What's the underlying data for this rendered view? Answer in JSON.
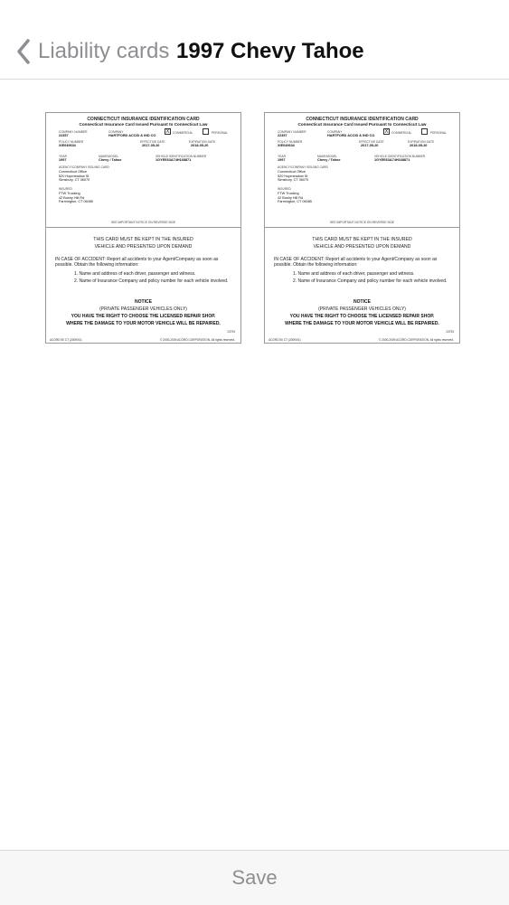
{
  "nav": {
    "back_label": "Liability cards",
    "title": "1997 Chevy Tahoe"
  },
  "cards": [
    {
      "title": "CONNECTICUT INSURANCE IDENTIFICATION CARD",
      "subtitle": "Connecticut Insurance Card Issued Pursuant to Connecticut Law",
      "company_number_label": "COMPANY NUMBER",
      "company_number": "22357",
      "company_label": "COMPANY",
      "company": "HARTFORD ACCID & IND CO",
      "commercial_label": "COMMERCIAL",
      "personal_label": "PERSONAL",
      "commercial_mark": "X",
      "policy_number_label": "POLICY NUMBER",
      "policy_number": "XIE049634",
      "effective_label": "EFFECTIVE DATE",
      "effective_date": "2017-05-20",
      "expiration_label": "EXPIRATION DATE",
      "expiration_date": "2018-05-20",
      "year_label": "YEAR",
      "year": "1997",
      "make_label": "MAKE/MODEL",
      "make_model": "Chevy / Tahoe",
      "vin_label": "VEHICLE IDENTIFICATION NUMBER",
      "vin": "1GYEE63A74H168871",
      "agency_label": "AGENCY/COMPANY ISSUING CARD",
      "agency": "Connecticut Office\n520 Hopmeadow St\nSimsbury, CT 06070",
      "insured_label": "INSURED",
      "insured": "FTW Trucking\n42 Bushy Hill Rd\nFarmington, CT 06085",
      "reverse_notice": "SEE IMPORTANT NOTICE ON REVERSE SIDE",
      "keep_line1": "THIS CARD MUST BE KEPT IN THE INSURED",
      "keep_line2": "VEHICLE AND PRESENTED UPON DEMAND",
      "accident_text": "IN CASE OF ACCIDENT:  Report all accidents to your Agent/Company as soon as possible. Obtain the following information:",
      "item1": "1. Name and address of each driver, passenger and witness.",
      "item2": "2. Name of Insurance Company and policy number for each vehicle involved.",
      "notice_title": "NOTICE",
      "notice_sub": "(PRIVATE PASSENGER VEHICLES ONLY)",
      "right_line1": "YOU HAVE THE RIGHT TO CHOOSE THE LICENSED REPAIR SHOP.",
      "right_line2": "WHERE THE DAMAGE TO YOUR MOTOR VEHICLE WILL BE REPAIRED.",
      "form_code": "13793",
      "footer_left": "ACORD 50 CT (2009/01)",
      "footer_right": "© 2000-2009 ACORD CORPORATION. All rights reserved."
    },
    {
      "title": "CONNECTICUT INSURANCE IDENTIFICATION CARD",
      "subtitle": "Connecticut Insurance Card Issued Pursuant to Connecticut Law",
      "company_number_label": "COMPANY NUMBER",
      "company_number": "22357",
      "company_label": "COMPANY",
      "company": "HARTFORD ACCID & IND CO",
      "commercial_label": "COMMERCIAL",
      "personal_label": "PERSONAL",
      "commercial_mark": "X",
      "policy_number_label": "POLICY NUMBER",
      "policy_number": "XIE049634",
      "effective_label": "EFFECTIVE DATE",
      "effective_date": "2017-05-20",
      "expiration_label": "EXPIRATION DATE",
      "expiration_date": "2018-05-20",
      "year_label": "YEAR",
      "year": "1997",
      "make_label": "MAKE/MODEL",
      "make_model": "Chevy / Tahoe",
      "vin_label": "VEHICLE IDENTIFICATION NUMBER",
      "vin": "1GYEE63A74H168871",
      "agency_label": "AGENCY/COMPANY ISSUING CARD",
      "agency": "Connecticut Office\n520 Hopmeadow St\nSimsbury, CT 06070",
      "insured_label": "INSURED",
      "insured": "FTW Trucking\n42 Bushy Hill Rd\nFarmington, CT 06085",
      "reverse_notice": "SEE IMPORTANT NOTICE ON REVERSE SIDE",
      "keep_line1": "THIS CARD MUST BE KEPT IN THE INSURED",
      "keep_line2": "VEHICLE AND PRESENTED UPON DEMAND",
      "accident_text": "IN CASE OF ACCIDENT:  Report all accidents to your Agent/Company as soon as possible. Obtain the following information:",
      "item1": "1. Name and address of each driver, passenger and witness.",
      "item2": "2. Name of Insurance Company and policy number for each vehicle involved.",
      "notice_title": "NOTICE",
      "notice_sub": "(PRIVATE PASSENGER VEHICLES ONLY)",
      "right_line1": "YOU HAVE THE RIGHT TO CHOOSE THE LICENSED REPAIR SHOP.",
      "right_line2": "WHERE THE DAMAGE TO YOUR MOTOR VEHICLE WILL BE REPAIRED.",
      "form_code": "13793",
      "footer_left": "ACORD 50 CT (2009/01)",
      "footer_right": "© 2000-2009 ACORD CORPORATION. All rights reserved."
    }
  ],
  "toolbar": {
    "save_label": "Save"
  },
  "colors": {
    "nav_text": "#111111",
    "back_text": "#8e8e93",
    "divider": "#d9d9d9",
    "toolbar_bg": "#f7f7f7"
  },
  "icons": {
    "back": "chevron-left-icon"
  }
}
